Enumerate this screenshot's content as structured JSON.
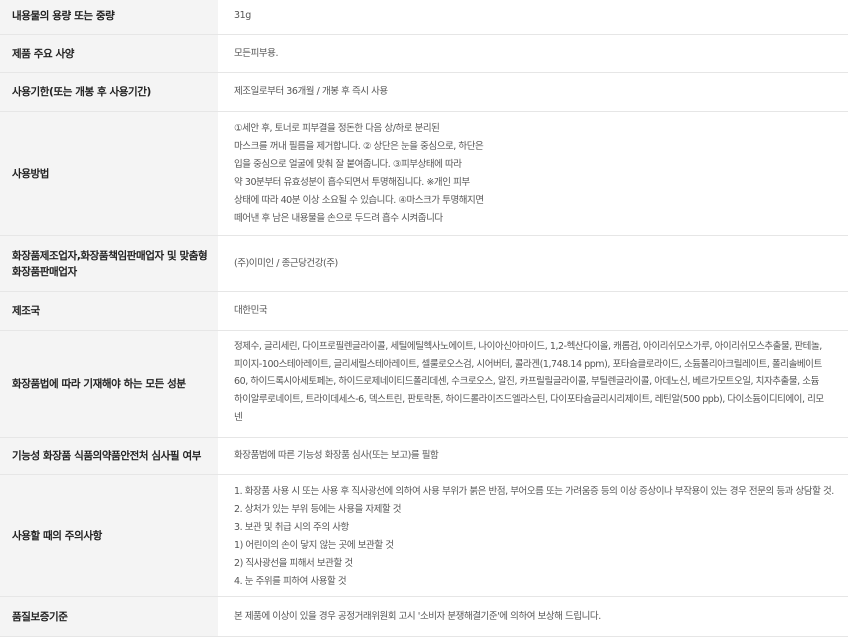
{
  "rows": [
    {
      "label": "내용물의 용량 또는 중량",
      "lines": [
        "31g"
      ]
    },
    {
      "label": "제품 주요 사양",
      "lines": [
        "모든피부용."
      ]
    },
    {
      "label": "사용기한(또는 개봉 후 사용기간)",
      "lines": [
        "제조일로부터 36개월 / 개봉 후 즉시 사용"
      ]
    },
    {
      "label": "사용방법",
      "lines": [
        "①세안 후, 토너로 피부결을 정돈한 다음 상/하로 분리된",
        "마스크를 꺼내 필름을 제거합니다. ② 상단은 눈을 중심으로, 하단은",
        "입을 중심으로 얼굴에 맞춰 잘 붙여줍니다. ③피부상태에 따라",
        "약 30분부터 유효성분이 흡수되면서 투명해집니다. ※개인 피부",
        "상태에 따라 40분 이상 소요될 수 있습니다. ④마스크가 투명해지면",
        "떼어낸 후 남은 내용물을 손으로 두드려 흡수 시켜줍니다"
      ]
    },
    {
      "label_lines": [
        "화장품제조업자,화장품책임판매업자 및 맞춤형",
        "화장품판매업자"
      ],
      "lines": [
        "(주)이미인 / 종근당건강(주)"
      ]
    },
    {
      "label": "제조국",
      "lines": [
        "대한민국"
      ]
    },
    {
      "label": "화장품법에 따라 기재해야 하는 모든 성분",
      "lines": [
        "정제수, 글리세린, 다이프로필렌글라이콜, 세틸에틸헥사노에이트, 나이아신아마이드, 1,2-헥산다이올, 캐롭검, 아이리쉬모스가루, 아이리쉬모스추출물, 판테놀,",
        "피이지-100스테아레이트, 글리세릴스테아레이트, 셀룰로오스검, 시어버터, 콜라겐(1,748.14 ppm), 포타슘클로라이드, 소듐폴리아크릴레이트, 폴리솔베이트",
        "60, 하이드록시아세토페논, 하이드로제네이티드폴리데센, 수크로오스, 알진, 카프릴릴글라이콜, 부틸렌글라이콜, 아데노신, 베르가모트오일, 치자추출물, 소듐",
        "하이알루로네이트, 트라이데세스-6, 덱스트린, 판토락톤, 하이드롤라이즈드엘라스틴, 다이포타슘글리시리제이트, 레틴알(500 ppb), 다이소듐이디티에이, 리모",
        "넨"
      ]
    },
    {
      "label": "기능성 화장품 식품의약품안전처 심사필 여부",
      "lines": [
        "화장품법에 따른 기능성 화장품 심사(또는 보고)를 필함"
      ]
    },
    {
      "label": "사용할 때의 주의사항",
      "lines": [
        "1. 화장품 사용 시 또는 사용 후 직사광선에 의하여 사용 부위가 붉은 반점, 부어오름 또는 가려움증 등의 이상 증상이나 부작용이 있는 경우 전문의 등과 상담할 것.",
        "2. 상처가 있는 부위 등에는 사용을 자제할 것",
        "3. 보관 및 취급 시의 주의 사항",
        "1) 어린이의 손이 닿지 않는 곳에 보관할 것",
        "2) 직사광선을 피해서 보관할 것",
        "4. 눈 주위를 피하여 사용할 것"
      ]
    },
    {
      "label": "품질보증기준",
      "lines": [
        "본 제품에 이상이 있을 경우 공정거래위원회 고시 '소비자 분쟁해결기준'에 의하여 보상해 드립니다."
      ]
    }
  ]
}
